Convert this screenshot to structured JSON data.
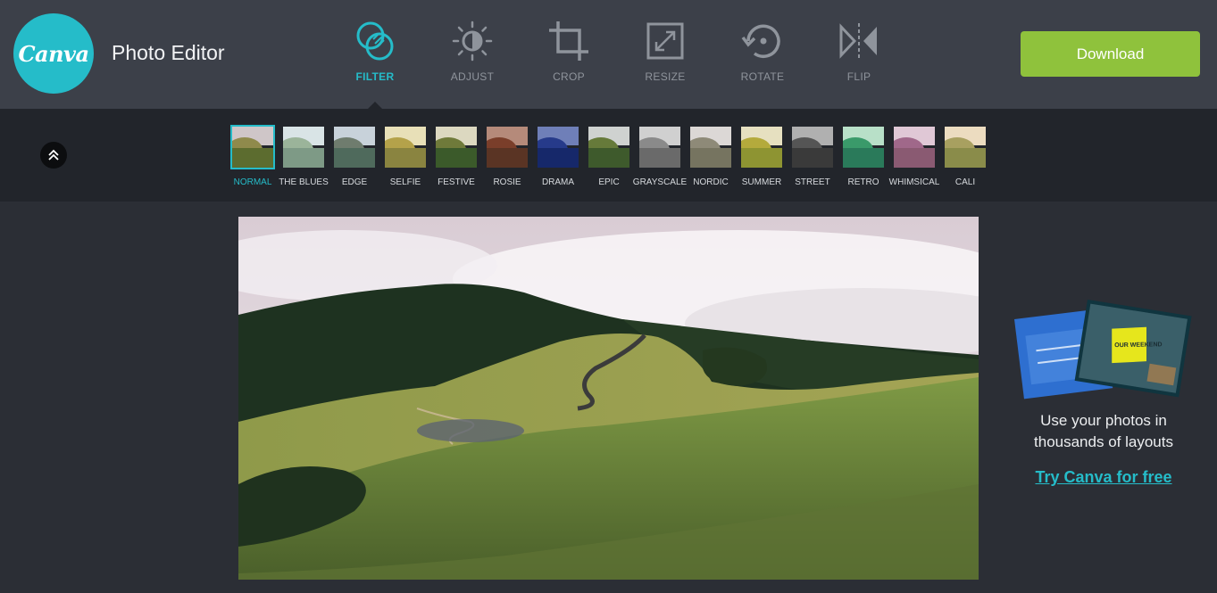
{
  "header": {
    "logo_text": "Canva",
    "title": "Photo Editor",
    "download_label": "Download"
  },
  "tools": [
    {
      "label": "FILTER",
      "icon": "filter-icon",
      "active": true
    },
    {
      "label": "ADJUST",
      "icon": "adjust-icon",
      "active": false
    },
    {
      "label": "CROP",
      "icon": "crop-icon",
      "active": false
    },
    {
      "label": "RESIZE",
      "icon": "resize-icon",
      "active": false
    },
    {
      "label": "ROTATE",
      "icon": "rotate-icon",
      "active": false
    },
    {
      "label": "FLIP",
      "icon": "flip-icon",
      "active": false
    }
  ],
  "filters": [
    {
      "label": "NORMAL",
      "active": true
    },
    {
      "label": "THE BLUES"
    },
    {
      "label": "EDGE"
    },
    {
      "label": "SELFIE"
    },
    {
      "label": "FESTIVE"
    },
    {
      "label": "ROSIE"
    },
    {
      "label": "DRAMA"
    },
    {
      "label": "EPIC"
    },
    {
      "label": "GRAYSCALE"
    },
    {
      "label": "NORDIC"
    },
    {
      "label": "SUMMER"
    },
    {
      "label": "STREET"
    },
    {
      "label": "RETRO"
    },
    {
      "label": "WHIMSICAL"
    },
    {
      "label": "CALI"
    }
  ],
  "promo": {
    "card_text": "OUR WEEKEND",
    "line1": "Use your photos in",
    "line2": "thousands of layouts",
    "link": "Try Canva for free"
  },
  "colors": {
    "accent": "#25bcc9",
    "download": "#8fc23c",
    "header_bg": "#3c4049",
    "body_bg": "#2b2e35"
  }
}
